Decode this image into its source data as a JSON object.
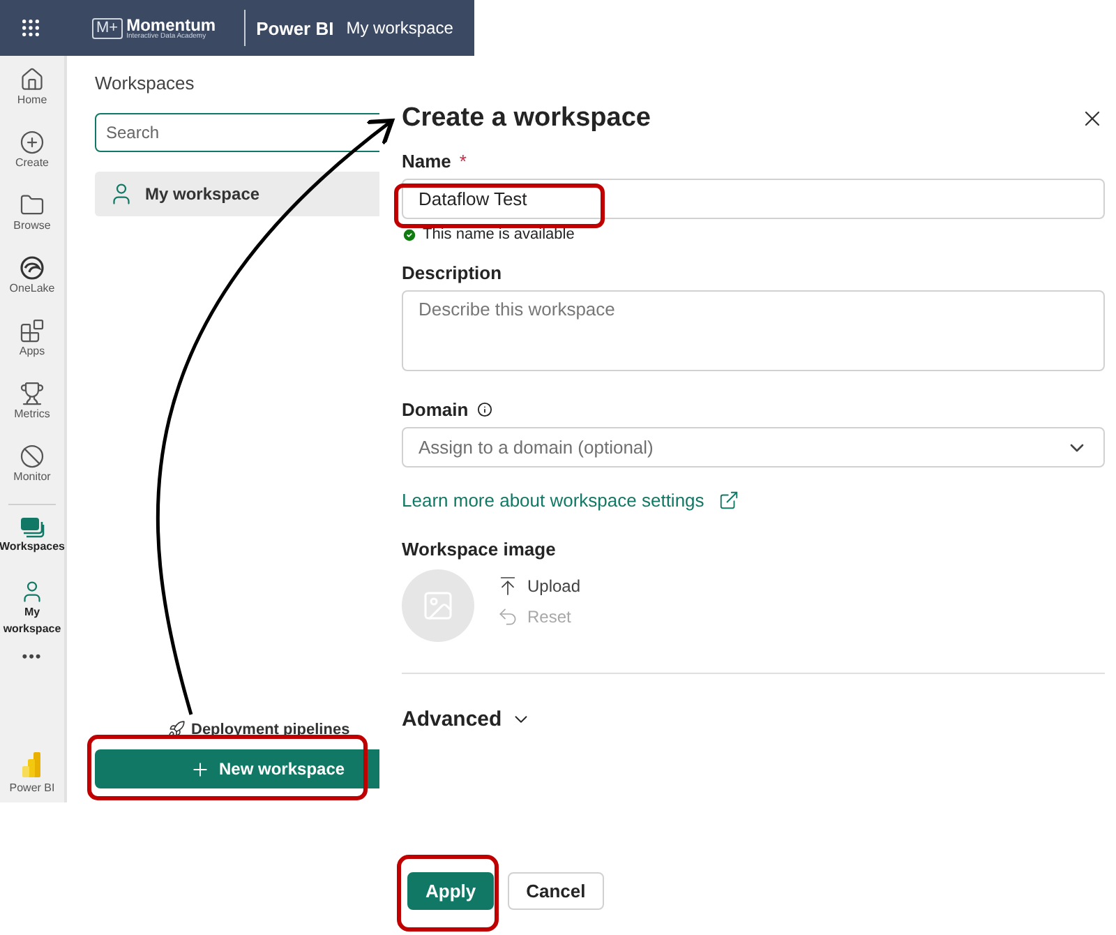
{
  "top_bar": {
    "brand": {
      "mark": "M+",
      "name": "Momentum",
      "tagline": "Interactive Data Academy"
    },
    "product": "Power BI",
    "location": "My workspace"
  },
  "nav": [
    {
      "label": "Home",
      "kind": "home",
      "selected": false
    },
    {
      "label": "Create",
      "kind": "create",
      "selected": false
    },
    {
      "label": "Browse",
      "kind": "browse",
      "selected": false
    },
    {
      "label": "OneLake",
      "kind": "onelake",
      "selected": false
    },
    {
      "label": "Apps",
      "kind": "apps",
      "selected": false
    },
    {
      "label": "Metrics",
      "kind": "metrics",
      "selected": false
    },
    {
      "label": "Monitor",
      "kind": "monitor",
      "selected": false
    },
    {
      "label": "Workspaces",
      "kind": "workspaces",
      "selected": true
    },
    {
      "label": "My workspace",
      "kind": "person",
      "selected": true
    }
  ],
  "nav_more": "•••",
  "app_switcher": "Power BI",
  "workspaces_panel": {
    "title": "Workspaces",
    "search": {
      "placeholder": "Search"
    },
    "items": [
      {
        "label": "My workspace",
        "selected": true
      }
    ],
    "deployment_link": "Deployment pipelines",
    "new_button": "New workspace"
  },
  "dialog": {
    "title": "Create a workspace",
    "name": {
      "label": "Name",
      "required_mark": "*",
      "value": "Dataflow Test",
      "validation": "This name is available"
    },
    "description": {
      "label": "Description",
      "placeholder": "Describe this workspace"
    },
    "domain": {
      "label": "Domain",
      "placeholder": "Assign to a domain (optional)"
    },
    "learn_more": "Learn more about workspace settings",
    "image": {
      "label": "Workspace image",
      "upload": {
        "label": "Upload",
        "disabled": false
      },
      "reset": {
        "label": "Reset",
        "disabled": true
      }
    },
    "advanced": {
      "label": "Advanced",
      "expanded": false
    },
    "buttons": [
      {
        "label": "Apply",
        "kind": "primary"
      },
      {
        "label": "Cancel",
        "kind": "secondary"
      }
    ]
  }
}
